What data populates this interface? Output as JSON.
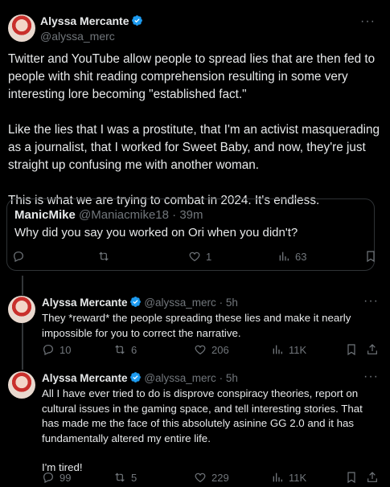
{
  "main_tweet": {
    "author_name": "Alyssa Mercante",
    "author_handle": "@alyssa_merc",
    "more_label": "···",
    "paragraphs": [
      "Twitter and YouTube allow people to spread lies that are then fed to people with shit reading comprehension resulting in some very interesting lore becoming \"established fact.\"",
      "Like the lies that I was a prostitute, that I'm an activist masquerading as a journalist, that I worked for Sweet Baby, and now, they're just straight up confusing me with another woman.",
      "This is what we are trying to combat in 2024. It's endless."
    ]
  },
  "quoted_tweet": {
    "author_name": "ManicMike",
    "author_handle": "@Maniacmike18",
    "separator": "·",
    "time": "39m",
    "text": "Why did you say you worked on Ori when you didn't?",
    "likes": "1",
    "views": "63"
  },
  "replies": [
    {
      "author_name": "Alyssa Mercante",
      "author_handle": "@alyssa_merc",
      "separator": "·",
      "time": "5h",
      "more_label": "···",
      "paragraphs": [
        "They *reward* the people spreading these lies and make it nearly impossible for you to correct the narrative."
      ],
      "replies": "10",
      "reposts": "6",
      "likes": "206",
      "views": "11K"
    },
    {
      "author_name": "Alyssa Mercante",
      "author_handle": "@alyssa_merc",
      "separator": "·",
      "time": "5h",
      "more_label": "···",
      "paragraphs": [
        "All I have ever tried to do is disprove conspiracy theories, report on cultural issues in the gaming space, and tell interesting stories. That has made me the face of this absolutely asinine GG 2.0 and it has fundamentally altered my entire life.",
        "I'm tired!"
      ],
      "replies": "99",
      "reposts": "5",
      "likes": "229",
      "views": "11K"
    }
  ],
  "colors": {
    "background": "#000000",
    "text": "#e7e9ea",
    "muted": "#71767b",
    "verified": "#1d9bf0",
    "border": "#2f3336"
  },
  "icons": [
    "verified-badge-icon",
    "more-icon",
    "reply-icon",
    "repost-icon",
    "like-icon",
    "views-icon",
    "bookmark-icon",
    "share-icon"
  ]
}
